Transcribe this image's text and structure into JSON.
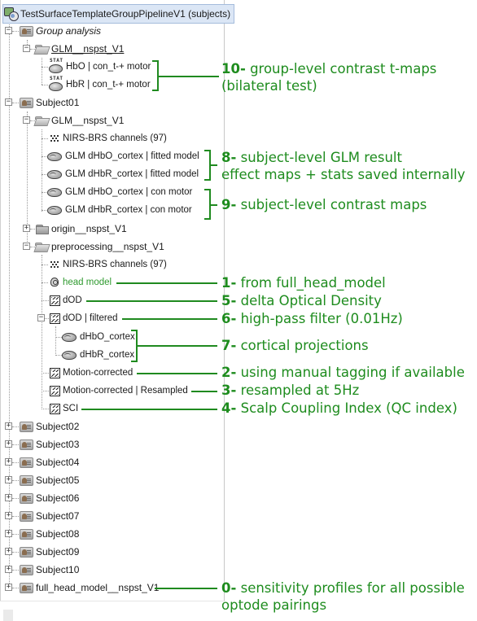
{
  "tree": {
    "root": {
      "label": "TestSurfaceTemplateGroupPipelineV1 (subjects)",
      "icon": "protocol-icon",
      "selected": true
    },
    "group_analysis": {
      "label": "Group analysis",
      "folder": {
        "label": "GLM__nspst_V1",
        "items": [
          {
            "label": "HbO | con_t-+ motor",
            "icon": "stat-brain-icon"
          },
          {
            "label": "HbR | con_t-+ motor",
            "icon": "stat-brain-icon"
          }
        ]
      }
    },
    "subject01": {
      "label": "Subject01",
      "glm_folder": {
        "label": "GLM__nspst_V1",
        "items": [
          {
            "label": "NIRS-BRS channels (97)",
            "icon": "channels-icon"
          },
          {
            "label": "GLM dHbO_cortex | fitted model",
            "icon": "cortex-icon"
          },
          {
            "label": "GLM dHbR_cortex | fitted model",
            "icon": "cortex-icon"
          },
          {
            "label": "GLM dHbO_cortex | con motor",
            "icon": "cortex-icon"
          },
          {
            "label": "GLM dHbR_cortex | con motor",
            "icon": "cortex-icon"
          }
        ]
      },
      "origin_folder": {
        "label": "origin__nspst_V1"
      },
      "preprocessing_folder": {
        "label": "preprocessing__nspst_V1",
        "items": [
          {
            "label": "NIRS-BRS channels (97)",
            "icon": "channels-icon"
          },
          {
            "label": "head model",
            "icon": "head-model-icon"
          },
          {
            "label": "dOD",
            "icon": "data-icon"
          },
          {
            "label": "dOD | filtered",
            "icon": "data-icon",
            "children": [
              {
                "label": "dHbO_cortex",
                "icon": "cortex-icon"
              },
              {
                "label": "dHbR_cortex",
                "icon": "cortex-icon"
              }
            ]
          },
          {
            "label": "Motion-corrected",
            "icon": "data-icon"
          },
          {
            "label": "Motion-corrected | Resampled",
            "icon": "data-icon"
          },
          {
            "label": "SCI",
            "icon": "data-icon"
          }
        ]
      }
    },
    "collapsed_subjects": [
      "Subject02",
      "Subject03",
      "Subject04",
      "Subject05",
      "Subject06",
      "Subject07",
      "Subject08",
      "Subject09",
      "Subject10"
    ],
    "full_head_model": {
      "label": "full_head_model__nspst_V1"
    },
    "expand_symbol": "+",
    "collapse_symbol": "−"
  },
  "annotations": {
    "a10": {
      "num": "10-",
      "line1": "group-level contrast t-maps",
      "line2": "(bilateral test)"
    },
    "a8": {
      "num": "8-",
      "line1": "subject-level GLM result",
      "line2": "effect maps + stats saved internally"
    },
    "a9": {
      "num": "9-",
      "line1": "subject-level contrast maps"
    },
    "a1": {
      "num": "1-",
      "line1": "from full_head_model"
    },
    "a5": {
      "num": "5-",
      "line1": "delta Optical Density"
    },
    "a6": {
      "num": "6-",
      "line1": "high-pass filter (0.01Hz)"
    },
    "a7": {
      "num": "7-",
      "line1": "cortical projections"
    },
    "a2": {
      "num": "2-",
      "line1": "using manual tagging if available"
    },
    "a3": {
      "num": "3-",
      "line1": "resampled at 5Hz"
    },
    "a4": {
      "num": "4-",
      "line1": "Scalp Coupling Index (QC index)"
    },
    "a0": {
      "num": "0-",
      "line1": "sensitivity profiles for all possible",
      "line2": "optode pairings"
    }
  },
  "colors": {
    "annotation_green": "#1e8c1e",
    "head_model_green": "#2f9a2f",
    "selection_bg": "#dbe6f5"
  }
}
